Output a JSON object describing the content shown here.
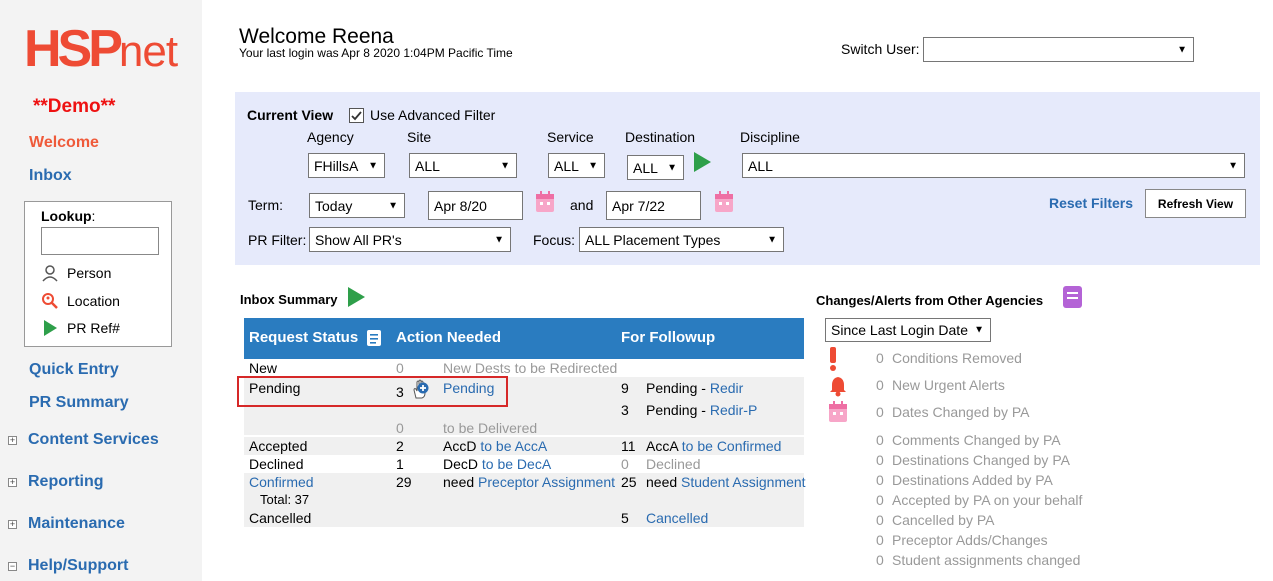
{
  "sidebar": {
    "logo_hsp": "HSP",
    "logo_net": "net",
    "demo": "**Demo**",
    "welcome": "Welcome",
    "inbox": "Inbox",
    "lookup_label": "Lookup",
    "lookup_colon": ":",
    "lookup_person": "Person",
    "lookup_location": "Location",
    "lookup_pr": "PR Ref#",
    "quick_entry": "Quick Entry",
    "pr_summary": "PR Summary",
    "content_services": "Content Services",
    "reporting": "Reporting",
    "maintenance": "Maintenance",
    "help": "Help/Support"
  },
  "header": {
    "welcome": "Welcome Reena",
    "last_login": "Your last login was Apr 8 2020 1:04PM Pacific Time",
    "switch_user_label": "Switch User:",
    "switch_user_value": ""
  },
  "filter": {
    "current_view": "Current View",
    "use_advanced": "Use Advanced Filter",
    "agency_label": "Agency",
    "agency_value": "FHillsA",
    "site_label": "Site",
    "site_value": "ALL",
    "service_label": "Service",
    "service_value": "ALL",
    "destination_label": "Destination",
    "destination_value": "ALL",
    "discipline_label": "Discipline",
    "discipline_value": "ALL",
    "term_label": "Term:",
    "term_value": "Today",
    "date_from": "Apr 8/20",
    "and": "and",
    "date_to": "Apr 7/22",
    "reset": "Reset Filters",
    "refresh": "Refresh View",
    "pr_filter_label": "PR Filter:",
    "pr_filter_value": "Show All PR's",
    "focus_label": "Focus:",
    "focus_value": "ALL Placement Types"
  },
  "inbox": {
    "title": "Inbox Summary",
    "col_status": "Request Status",
    "col_action": "Action Needed",
    "col_followup": "For Followup",
    "new": {
      "status": "New",
      "count": "0",
      "text": "New Dests to be Redirected"
    },
    "pending": {
      "status": "Pending",
      "count": "3",
      "link": "Pending",
      "f1_count": "9",
      "f1_text": "Pending - ",
      "f1_link": "Redir",
      "f2_count": "3",
      "f2_text": "Pending - ",
      "f2_link": "Redir-P",
      "d_count": "0",
      "d_text": "to be Delivered"
    },
    "accepted": {
      "status": "Accepted",
      "count": "2",
      "text": "AccD ",
      "link": "to be AccA",
      "f_count": "11",
      "f_text": "AccA ",
      "f_link": "to be Confirmed"
    },
    "declined": {
      "status": "Declined",
      "count": "1",
      "text": "DecD ",
      "link": "to be DecA",
      "f_count": "0",
      "f_text": "Declined"
    },
    "confirmed": {
      "status": "Confirmed",
      "total": "Total: 37",
      "count": "29",
      "text": "need ",
      "link": "Preceptor Assignment",
      "f_count": "25",
      "f_text": "need ",
      "f_link": "Student Assignment"
    },
    "cancelled": {
      "status": "Cancelled",
      "f_count": "5",
      "f_link": "Cancelled"
    }
  },
  "alerts": {
    "title": "Changes/Alerts from Other Agencies",
    "since_value": "Since Last Login Date",
    "items": [
      {
        "count": "0",
        "label": "Conditions Removed"
      },
      {
        "count": "0",
        "label": "New Urgent Alerts"
      },
      {
        "count": "0",
        "label": "Dates Changed by PA"
      },
      {
        "count": "0",
        "label": "Comments Changed by PA"
      },
      {
        "count": "0",
        "label": "Destinations Changed by PA"
      },
      {
        "count": "0",
        "label": "Destinations Added by PA"
      },
      {
        "count": "0",
        "label": "Accepted by PA on your behalf"
      },
      {
        "count": "0",
        "label": "Cancelled by PA"
      },
      {
        "count": "0",
        "label": "Preceptor Adds/Changes"
      },
      {
        "count": "0",
        "label": "Student assignments changed"
      }
    ]
  },
  "colors": {
    "accent": "#2a7cc0",
    "brand": "#ee4b34",
    "highlight": "#d62828",
    "filter_bg": "#e6eafb"
  }
}
